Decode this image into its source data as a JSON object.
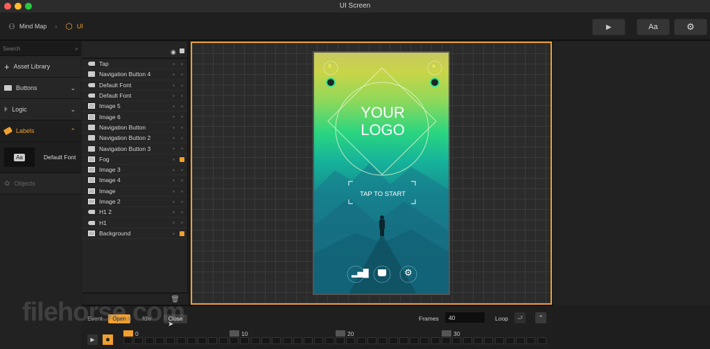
{
  "window": {
    "title": "UI Screen",
    "traffic_lights": {
      "close": "#ff5f57",
      "minimize": "#febc2e",
      "maximize": "#28c840"
    }
  },
  "breadcrumb": [
    {
      "label": "Mind Map",
      "icon": "hierarchy-icon"
    },
    {
      "label": "UI",
      "icon": "cube-icon",
      "active": true
    }
  ],
  "toolbar": {
    "play_icon": "▶",
    "font_label": "Aa",
    "settings_icon": "⚙"
  },
  "sidebar": {
    "search_placeholder": "Search",
    "sections": [
      {
        "label": "Asset Library",
        "icon": "plus-icon"
      },
      {
        "label": "Buttons",
        "icon": "button-icon",
        "chevron": "⌄"
      },
      {
        "label": "Logic",
        "icon": "logic-icon",
        "chevron": "⌄"
      },
      {
        "label": "Labels",
        "icon": "tag-icon",
        "chevron": "⌃",
        "expanded": true
      }
    ],
    "label_item": {
      "label": "Default Font",
      "icon_text": "Aa"
    },
    "objects_label": "Objects"
  },
  "layers": {
    "rows": [
      {
        "name": "Tap",
        "type": "label",
        "locked": false
      },
      {
        "name": "Navigation Button 4",
        "type": "button",
        "locked": false
      },
      {
        "name": "Default Font",
        "type": "label",
        "locked": false
      },
      {
        "name": "Default Font",
        "type": "label",
        "locked": false
      },
      {
        "name": "Image 5",
        "type": "image",
        "locked": false
      },
      {
        "name": "Image 6",
        "type": "image",
        "locked": false
      },
      {
        "name": "Navigation Button",
        "type": "button",
        "locked": false
      },
      {
        "name": "Navigation Button 2",
        "type": "button",
        "locked": false
      },
      {
        "name": "Navigation Button 3",
        "type": "button",
        "locked": false
      },
      {
        "name": "Fog",
        "type": "image",
        "locked": true
      },
      {
        "name": "Image 3",
        "type": "image",
        "locked": false
      },
      {
        "name": "Image 4",
        "type": "image",
        "locked": false
      },
      {
        "name": "Image",
        "type": "image",
        "locked": false
      },
      {
        "name": "Image 2",
        "type": "image",
        "locked": false
      },
      {
        "name": "H1 2",
        "type": "label",
        "locked": false
      },
      {
        "name": "H1",
        "type": "label",
        "locked": false
      },
      {
        "name": "Background",
        "type": "image",
        "locked": true
      }
    ]
  },
  "phone": {
    "logo_line1": "YOUR",
    "logo_line2": "LOGO",
    "tap_to_start": "TAP TO START",
    "bottom_icons": [
      "stats-icon",
      "shop-bag-icon",
      "settings-icon"
    ]
  },
  "timeline": {
    "event_label": "Event",
    "events": [
      {
        "label": "Open",
        "active": true
      },
      {
        "label": "Idle",
        "active": false
      },
      {
        "label": "Close",
        "active": false,
        "hover": true
      }
    ],
    "frames_label": "Frames",
    "frames_value": "40",
    "loop_label": "Loop",
    "markers": [
      "0",
      "10",
      "20",
      "30"
    ]
  },
  "accent_color": "#f0a030"
}
